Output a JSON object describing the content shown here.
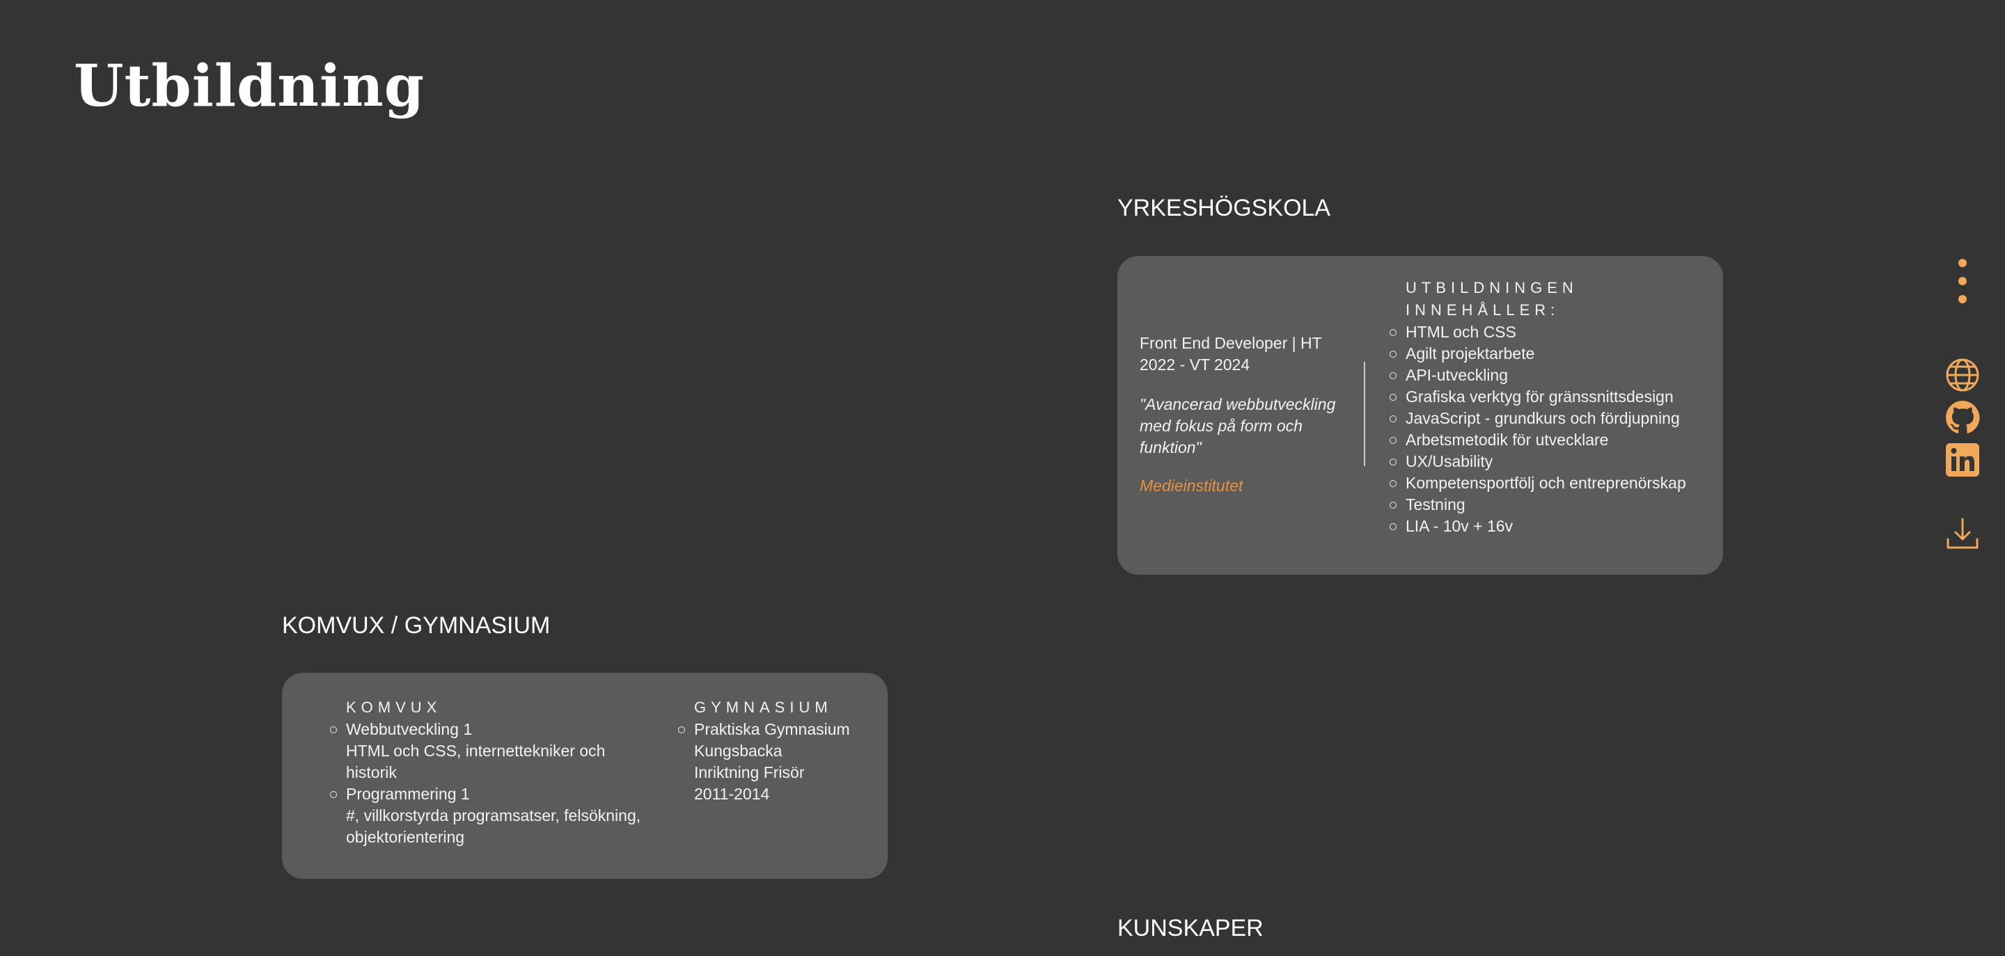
{
  "page": {
    "title": "Utbildning"
  },
  "yrkeshogskola": {
    "heading": "YRKESHÖGSKOLA",
    "program": "Front End Developer | HT 2022 - VT 2024",
    "quote": "\"Avancerad webbutveckling med fokus på form och funktion\"",
    "school": "Medieinstitutet",
    "content_heading": "UTBILDNINGEN INNEHÅLLER:",
    "items": [
      "HTML och CSS",
      "Agilt projektarbete",
      "API-utveckling",
      "Grafiska verktyg för gränssnittsdesign",
      "JavaScript - grundkurs och fördjupning",
      "Arbetsmetodik för utvecklare",
      "UX/Usability",
      "Kompetensportfölj och entreprenörskap",
      "Testning",
      "LIA - 10v + 16v"
    ]
  },
  "komvux_gymnasium": {
    "heading": "KOMVUX / GYMNASIUM",
    "komvux_heading": "KOMVUX",
    "komvux_items": [
      {
        "title": "Webbutveckling 1",
        "detail": "HTML och CSS, internettekniker och historik"
      },
      {
        "title": "Programmering 1",
        "detail": "#, villkorstyrda programsatser, felsökning, objektorientering"
      }
    ],
    "gymnasium_heading": "GYMNASIUM",
    "gymnasium_item": {
      "school": "Praktiska Gymnasium Kungsbacka",
      "track": "Inriktning Frisör",
      "years": "2011-2014"
    }
  },
  "kunskaper": {
    "heading": "KUNSKAPER"
  },
  "rail": {
    "icons": [
      "more-vertical-icon",
      "globe-icon",
      "github-icon",
      "linkedin-icon",
      "download-icon"
    ],
    "accent": "#f0a85a"
  },
  "colors": {
    "background": "#343434",
    "card": "#5b5b5b",
    "school_accent": "#e8913f"
  }
}
